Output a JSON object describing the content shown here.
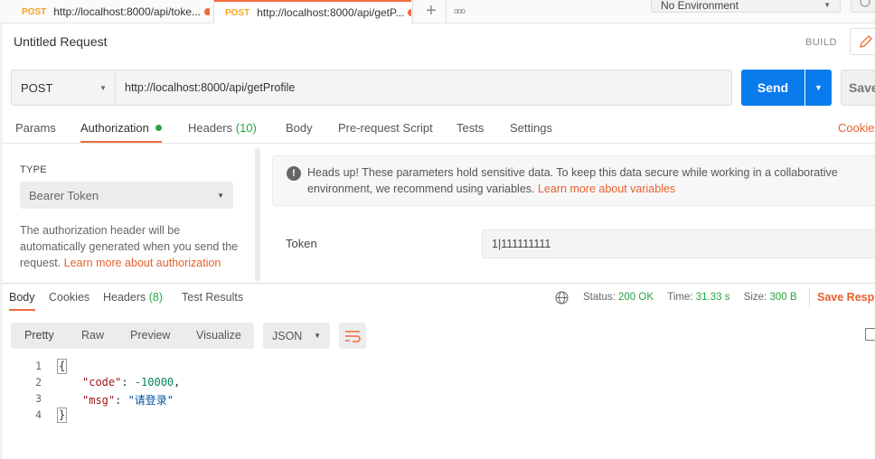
{
  "tabs": [
    {
      "method": "POST",
      "title": "http://localhost:8000/api/toke..."
    },
    {
      "method": "POST",
      "title": "http://localhost:8000/api/getP..."
    }
  ],
  "tab_actions": {
    "add": "+",
    "more": "ooo"
  },
  "environment": {
    "selected": "No Environment"
  },
  "request": {
    "name": "Untitled Request",
    "build_label": "BUILD",
    "method": "POST",
    "url": "http://localhost:8000/api/getProfile",
    "send_label": "Send",
    "save_label": "Save"
  },
  "request_tabs": {
    "params": "Params",
    "authorization": "Authorization",
    "headers": "Headers",
    "headers_count": "(10)",
    "body": "Body",
    "prerequest": "Pre-request Script",
    "tests": "Tests",
    "settings": "Settings",
    "cookies": "Cookies"
  },
  "auth": {
    "type_label": "TYPE",
    "type_value": "Bearer Token",
    "description": "The authorization header will be automatically generated when you send the request.",
    "learn_more": "Learn more about authorization",
    "notice_text": "Heads up! These parameters hold sensitive data. To keep this data secure while working in a collaborative environment, we recommend using variables.",
    "notice_link": "Learn more about variables",
    "token_label": "Token",
    "token_value": "1|111111111"
  },
  "response": {
    "tabs": {
      "body": "Body",
      "cookies": "Cookies",
      "headers": "Headers",
      "headers_count": "(8)",
      "tests": "Test Results"
    },
    "status_label": "Status:",
    "status_value": "200 OK",
    "time_label": "Time:",
    "time_value": "31.33 s",
    "size_label": "Size:",
    "size_value": "300 B",
    "save_label": "Save Respo",
    "views": {
      "pretty": "Pretty",
      "raw": "Raw",
      "preview": "Preview",
      "visualize": "Visualize"
    },
    "format": "JSON",
    "lines": [
      "1",
      "2",
      "3",
      "4"
    ],
    "body": {
      "open": "{",
      "code_key": "\"code\"",
      "code_value": "-10000",
      "msg_key": "\"msg\"",
      "msg_value": "\"请登录\"",
      "close": "}"
    }
  },
  "colors": {
    "accent": "#f26b3a",
    "send": "#097bed",
    "status": "#26a544"
  }
}
